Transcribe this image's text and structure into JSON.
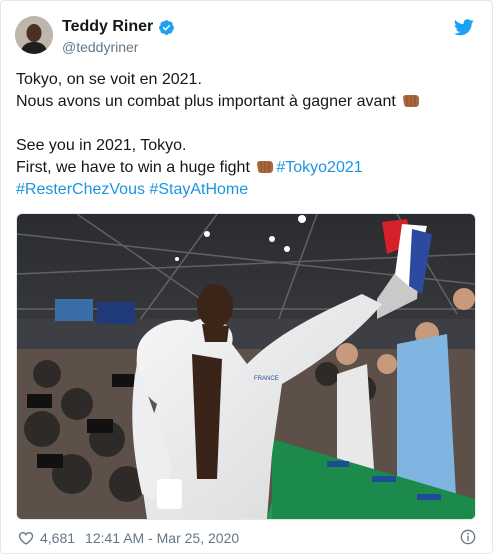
{
  "author": {
    "name": "Teddy Riner",
    "handle": "@teddyriner",
    "verified_icon": "verified-badge-icon"
  },
  "tweet": {
    "line1": "Tokyo, on se voit en 2021.",
    "line2": "Nous avons un combat plus important à gagner avant",
    "line3": "See you in 2021, Tokyo.",
    "line4": "First, we have to win a huge fight",
    "hashtag_tokyo": "#Tokyo2021",
    "hashtag_rester": "#ResterChezVous",
    "hashtag_stay": "#StayAtHome",
    "emoji": "fist-bump-emoji"
  },
  "footer": {
    "likes": "4,681",
    "dot": "·",
    "timestamp": "12:41 AM - Mar 25, 2020"
  },
  "colors": {
    "link": "#1b95e0",
    "muted": "#657786",
    "twitter_blue": "#1da1f2"
  }
}
